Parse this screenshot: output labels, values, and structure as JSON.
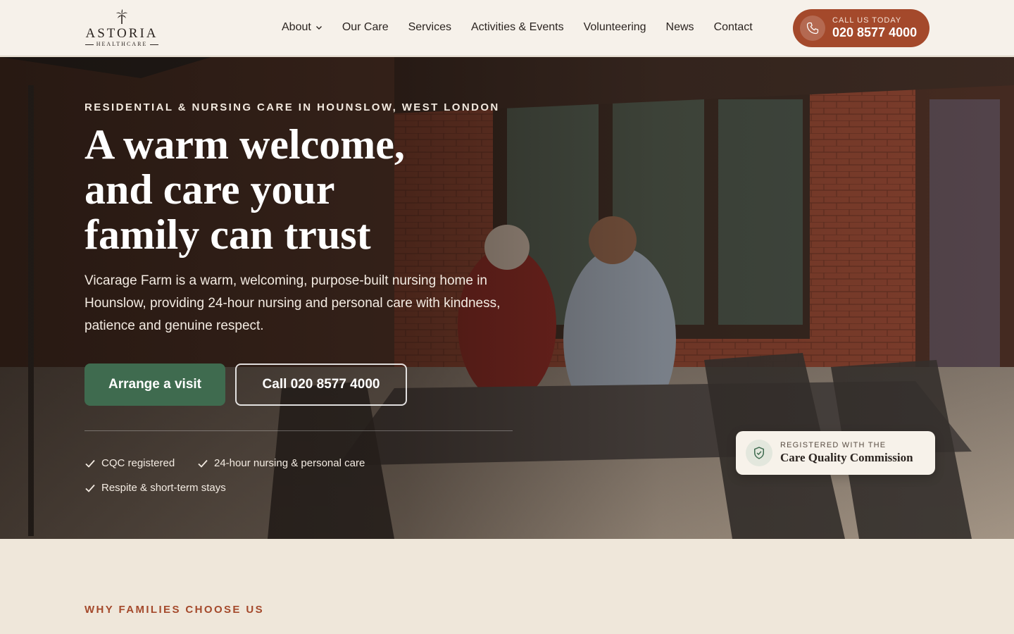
{
  "brand": {
    "name": "ASTORIA",
    "subname": "HEALTHCARE"
  },
  "nav": {
    "items": [
      {
        "label": "About",
        "has_dropdown": true
      },
      {
        "label": "Our Care"
      },
      {
        "label": "Services"
      },
      {
        "label": "Activities & Events"
      },
      {
        "label": "Volunteering"
      },
      {
        "label": "News"
      },
      {
        "label": "Contact"
      }
    ]
  },
  "call_pill": {
    "label": "CALL US TODAY",
    "number": "020 8577 4000"
  },
  "hero": {
    "eyebrow": "RESIDENTIAL & NURSING CARE IN HOUNSLOW, WEST LONDON",
    "headline_1": "A warm welcome,",
    "headline_2": "and care your",
    "headline_3": "family can trust",
    "lead": "Vicarage Farm is a warm, welcoming, purpose-built nursing home in Hounslow, providing 24-hour nursing and personal care with kindness, patience and genuine respect.",
    "primary_cta": "Arrange a visit",
    "secondary_cta": "Call 020 8577 4000",
    "checks": [
      "CQC registered",
      "24-hour nursing & personal care",
      "Respite & short-term stays"
    ]
  },
  "cqc": {
    "line1": "REGISTERED WITH THE",
    "line2": "Care Quality Commission"
  },
  "next_section": {
    "eyebrow": "WHY FAMILIES CHOOSE US"
  },
  "colors": {
    "accent": "#a4492b",
    "green": "#3f6b4f",
    "cream": "#f6f1ea",
    "sand": "#efe7da"
  }
}
